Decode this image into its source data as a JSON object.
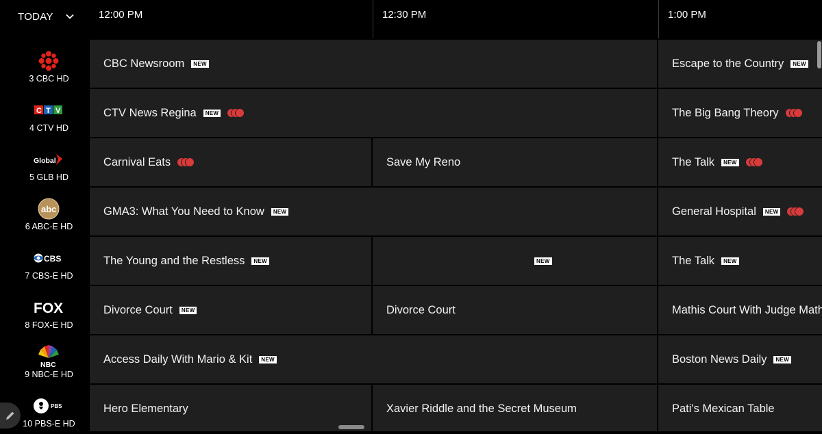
{
  "day_selector": {
    "label": "TODAY",
    "icon": "chevron-down-icon"
  },
  "time_slots": [
    "12:00 PM",
    "12:30 PM",
    "1:00 PM"
  ],
  "channels": [
    {
      "number": "3 CBC HD",
      "logo": "CBC"
    },
    {
      "number": "4 CTV HD",
      "logo": "CTV"
    },
    {
      "number": "5 GLB HD",
      "logo": "Global"
    },
    {
      "number": "6 ABC-E HD",
      "logo": "abc"
    },
    {
      "number": "7 CBS-E HD",
      "logo": "CBS"
    },
    {
      "number": "8 FOX-E HD",
      "logo": "FOX"
    },
    {
      "number": "9 NBC-E HD",
      "logo": "NBC"
    },
    {
      "number": "10 PBS-E HD",
      "logo": "PBS"
    }
  ],
  "badge_text": "NEW",
  "programs": [
    [
      {
        "title": "CBC Newsroom",
        "new": true,
        "rec": false
      },
      {
        "title": "Escape to the Country",
        "new": true,
        "rec": false
      }
    ],
    [
      {
        "title": "CTV News Regina",
        "new": true,
        "rec": true
      },
      {
        "title": "The Big Bang Theory",
        "new": false,
        "rec": true
      }
    ],
    [
      {
        "title": "Carnival Eats",
        "new": false,
        "rec": true
      },
      {
        "title": "Save My Reno",
        "new": false,
        "rec": false
      },
      {
        "title": "The Talk",
        "new": true,
        "rec": true
      }
    ],
    [
      {
        "title": "GMA3: What You Need to Know",
        "new": true,
        "rec": false
      },
      {
        "title": "General Hospital",
        "new": true,
        "rec": true
      }
    ],
    [
      {
        "title": "The Young and the Restless",
        "new": true,
        "rec": false
      },
      {
        "title": "",
        "new": true,
        "rec": false
      },
      {
        "title": "The Talk",
        "new": true,
        "rec": false
      }
    ],
    [
      {
        "title": "Divorce Court",
        "new": true,
        "rec": false
      },
      {
        "title": "Divorce Court",
        "new": false,
        "rec": false
      },
      {
        "title": "Mathis Court With Judge Mathis",
        "new": false,
        "rec": false
      }
    ],
    [
      {
        "title": "Access Daily With Mario & Kit",
        "new": true,
        "rec": false
      },
      {
        "title": "Boston News Daily",
        "new": true,
        "rec": false
      }
    ],
    [
      {
        "title": "Hero Elementary",
        "new": false,
        "rec": false
      },
      {
        "title": "Xavier Riddle and the Secret Museum",
        "new": false,
        "rec": false
      },
      {
        "title": "Pati's Mexican Table",
        "new": false,
        "rec": false
      }
    ]
  ],
  "colors": {
    "background": "#000000",
    "cell": "#1f1f1f",
    "record": "#d93a3a"
  }
}
